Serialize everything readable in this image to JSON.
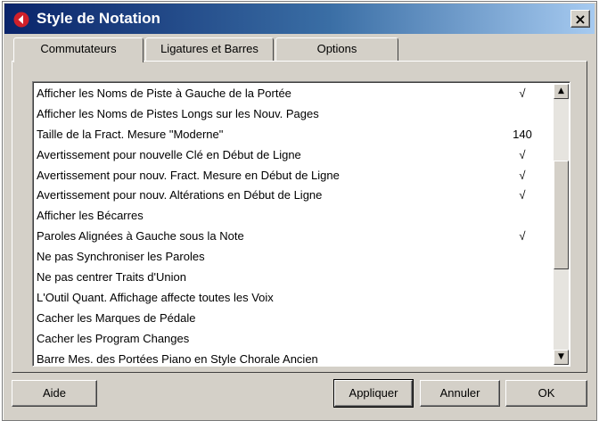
{
  "window": {
    "title": "Style de Notation",
    "close_glyph": "×"
  },
  "tabs": [
    {
      "label": "Commutateurs",
      "active": true
    },
    {
      "label": "Ligatures et Barres",
      "active": false
    },
    {
      "label": "Options",
      "active": false
    }
  ],
  "list": {
    "rows": [
      {
        "label": "Afficher les Noms de Piste à Gauche de la Portée",
        "value": "√"
      },
      {
        "label": "Afficher les Noms de Pistes Longs sur les Nouv. Pages",
        "value": ""
      },
      {
        "label": "Taille de la Fract. Mesure \"Moderne\"",
        "value": "140"
      },
      {
        "label": "Avertissement pour nouvelle Clé en Début de Ligne",
        "value": "√"
      },
      {
        "label": "Avertissement pour nouv. Fract. Mesure en Début de Ligne",
        "value": "√"
      },
      {
        "label": "Avertissement pour nouv. Altérations en Début de Ligne",
        "value": "√"
      },
      {
        "label": "Afficher les Bécarres",
        "value": ""
      },
      {
        "label": "Paroles Alignées à Gauche sous la Note",
        "value": "√"
      },
      {
        "label": "Ne pas Synchroniser les Paroles",
        "value": ""
      },
      {
        "label": "Ne pas centrer Traits d'Union",
        "value": ""
      },
      {
        "label": "L'Outil Quant. Affichage affecte toutes les Voix",
        "value": ""
      },
      {
        "label": "Cacher les Marques de Pédale",
        "value": ""
      },
      {
        "label": "Cacher les Program Changes",
        "value": ""
      },
      {
        "label": "Barre Mes. des Portées Piano en Style Chorale Ancien",
        "value": ""
      }
    ],
    "scroll_up_glyph": "▲",
    "scroll_down_glyph": "▼"
  },
  "buttons": {
    "help": "Aide",
    "apply": "Appliquer",
    "cancel": "Annuler",
    "ok": "OK"
  },
  "icons": {
    "app": "cubase-logo-icon",
    "close": "close-icon",
    "scroll_up": "arrow-up-icon",
    "scroll_down": "arrow-down-icon"
  },
  "colors": {
    "title_bar_start": "#0a246a",
    "title_bar_end": "#a6caf0",
    "face": "#d4d0c8",
    "logo_red": "#d0202a"
  }
}
